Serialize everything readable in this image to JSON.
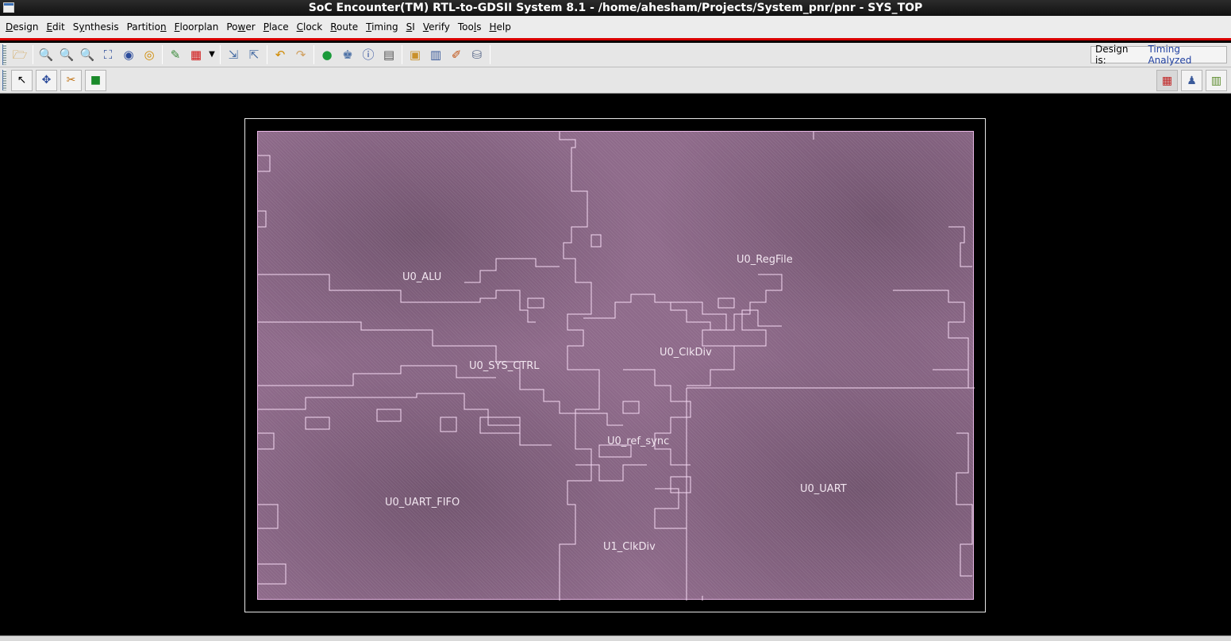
{
  "window": {
    "title": "SoC Encounter(TM) RTL-to-GDSII System 8.1 - /home/ahesham/Projects/System_pnr/pnr - SYS_TOP"
  },
  "menu": [
    {
      "label": "Design",
      "mnemonic": "D"
    },
    {
      "label": "Edit",
      "mnemonic": "E"
    },
    {
      "label": "Synthesis",
      "mnemonic": "y"
    },
    {
      "label": "Partition",
      "mnemonic": "n"
    },
    {
      "label": "Floorplan",
      "mnemonic": "F"
    },
    {
      "label": "Power",
      "mnemonic": "w"
    },
    {
      "label": "Place",
      "mnemonic": "P"
    },
    {
      "label": "Clock",
      "mnemonic": "C"
    },
    {
      "label": "Route",
      "mnemonic": "R"
    },
    {
      "label": "Timing",
      "mnemonic": "T"
    },
    {
      "label": "SI",
      "mnemonic": "S"
    },
    {
      "label": "Verify",
      "mnemonic": "V"
    },
    {
      "label": "Tools",
      "mnemonic": "l"
    },
    {
      "label": "Help",
      "mnemonic": "H"
    }
  ],
  "toolbar": {
    "status_label": "Design is:",
    "status_value": "Timing Analyzed"
  },
  "icons": {
    "open": "folder-icon",
    "zoom_in": "zoom-in-icon",
    "zoom_out": "zoom-out-icon",
    "zoom_area": "zoom-area-icon",
    "fit": "fit-icon",
    "previous": "zoom-previous-icon",
    "redraw": "redraw-icon",
    "colors": "color-icon",
    "palette": "palette-icon",
    "undo": "undo-icon",
    "redo": "redo-icon"
  },
  "layout_view": {
    "instances": [
      {
        "name": "U0_RegFile"
      },
      {
        "name": "U0_ALU"
      },
      {
        "name": "U0_SYS_CTRL"
      },
      {
        "name": "U0_ClkDiv"
      },
      {
        "name": "U0_ref_sync"
      },
      {
        "name": "U0_UART"
      },
      {
        "name": "U0_UART_FIFO"
      },
      {
        "name": "U1_ClkDiv"
      }
    ]
  }
}
